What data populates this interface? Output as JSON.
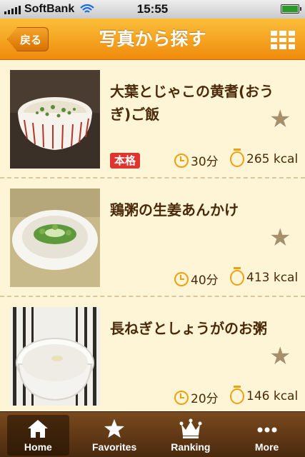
{
  "status_bar": {
    "carrier": "SoftBank",
    "time": "15:55"
  },
  "nav": {
    "back_label": "戻る",
    "title": "写真から探す"
  },
  "recipes": [
    {
      "title": "大葉とじゃこの黄耆(おうぎ)ご飯",
      "badge": "本格",
      "time": "30分",
      "kcal": "265 kcal"
    },
    {
      "title": "鶏粥の生姜あんかけ",
      "badge": "",
      "time": "40分",
      "kcal": "413 kcal"
    },
    {
      "title": "長ねぎとしょうがのお粥",
      "badge": "",
      "time": "20分",
      "kcal": "146 kcal"
    }
  ],
  "tabs": [
    {
      "label": "Home",
      "icon": "home-icon",
      "active": true
    },
    {
      "label": "Favorites",
      "icon": "star-icon",
      "active": false
    },
    {
      "label": "Ranking",
      "icon": "crown-icon",
      "active": false
    },
    {
      "label": "More",
      "icon": "more-icon",
      "active": false
    }
  ],
  "colors": {
    "nav_orange": "#f5a020",
    "list_background": "#fdf5d6",
    "title_brown": "#4a2a0a",
    "badge_red": "#e0342f",
    "icon_orange": "#f0a010",
    "tab_bar_brown": "#5c3514"
  }
}
